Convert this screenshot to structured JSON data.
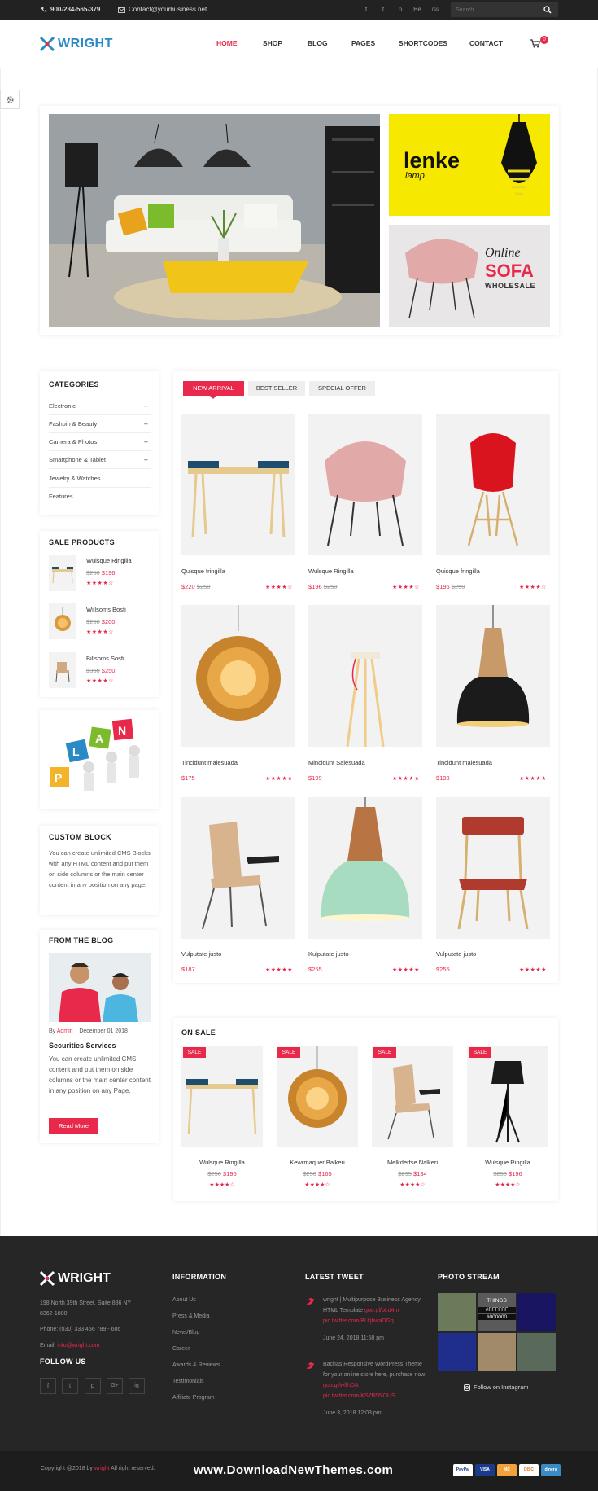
{
  "topbar": {
    "phone": "900-234-565-379",
    "email": "Contact@yourbusiness.net",
    "social": [
      "f",
      "t",
      "p",
      "Bē",
      "rss"
    ],
    "search_placeholder": "Search..."
  },
  "header": {
    "logo": "WRIGHT",
    "nav": [
      "HOME",
      "SHOP",
      "BLOG",
      "PAGES",
      "SHORTCODES",
      "CONTACT"
    ],
    "active_nav": "HOME",
    "cart_count": "0"
  },
  "hero": {
    "lenke_title": "lenke",
    "lenke_sub": "lamp",
    "sofa_line1": "Online",
    "sofa_line2": "SOFA",
    "sofa_line3": "WHOLESALE"
  },
  "categories": {
    "title": "CATEGORIES",
    "items": [
      {
        "label": "Electronic",
        "plus": "+"
      },
      {
        "label": "Fashoin & Beauty",
        "plus": "+"
      },
      {
        "label": "Camera & Photos",
        "plus": "+"
      },
      {
        "label": "Smartphone & Tablet",
        "plus": "+"
      },
      {
        "label": "Jewelry & Watches",
        "plus": ""
      },
      {
        "label": "Features",
        "plus": ""
      }
    ]
  },
  "sale_products": {
    "title": "SALE PRODUCTS",
    "items": [
      {
        "name": "Wulsque Ringilla",
        "old": "$250",
        "new": "$196",
        "stars": "★★★★☆"
      },
      {
        "name": "Willsoms Bosfi",
        "old": "$250",
        "new": "$200",
        "stars": "★★★★☆"
      },
      {
        "name": "Billsoms Sosfi",
        "old": "$350",
        "new": "$250",
        "stars": "★★★★☆"
      }
    ]
  },
  "plan_banner": {
    "letters": [
      "P",
      "L",
      "A",
      "N"
    ]
  },
  "custom_block": {
    "title": "CUSTOM BLOCK",
    "text": "You can create unlimited CMS Blocks with any HTML content and put them on side columns or the main center content in any position on any page."
  },
  "blog": {
    "title": "FROM THE BLOG",
    "by": "By",
    "author": "Admin",
    "date": "December 01 2018",
    "post_title": "Securities Services",
    "text": "You can create unlimited CMS content and put them on side columns or the main center content in any position on any Page.",
    "button": "Read More"
  },
  "tabs": [
    "NEW ARRIVAL",
    "BEST SELLER",
    "SPECIAL OFFER"
  ],
  "products": [
    {
      "name": "Quisque fringilla",
      "price": "$220",
      "old": "$250",
      "stars": "★★★★☆"
    },
    {
      "name": "Wulsque Ringilla",
      "price": "$196",
      "old": "$250",
      "stars": "★★★★☆"
    },
    {
      "name": "Quisque fringilla",
      "price": "$196",
      "old": "$250",
      "stars": "★★★★☆"
    },
    {
      "name": "Tincidunt malesuada",
      "price": "$175",
      "old": "",
      "stars": "★★★★★"
    },
    {
      "name": "Mincidunt Salesuada",
      "price": "$199",
      "old": "",
      "stars": "★★★★★"
    },
    {
      "name": "Tincidunt malesuada",
      "price": "$199",
      "old": "",
      "stars": "★★★★★"
    },
    {
      "name": "Vulputate justo",
      "price": "$187",
      "old": "",
      "stars": "★★★★★"
    },
    {
      "name": "Kulputate justo",
      "price": "$255",
      "old": "",
      "stars": "★★★★★"
    },
    {
      "name": "Vulputate justo",
      "price": "$255",
      "old": "",
      "stars": "★★★★★"
    }
  ],
  "on_sale": {
    "title": "ON SALE",
    "badge": "SALE",
    "items": [
      {
        "name": "Wulsque Ringilla",
        "old": "$250",
        "new": "$196",
        "stars": "★★★★☆"
      },
      {
        "name": "Kewrmaquer Balkeri",
        "old": "$250",
        "new": "$165",
        "stars": "★★★★☆"
      },
      {
        "name": "Melkderfse Nalkeri",
        "old": "$295",
        "new": "$134",
        "stars": "★★★★☆"
      },
      {
        "name": "Wulsque Ringilla",
        "old": "$250",
        "new": "$196",
        "stars": "★★★★☆"
      }
    ]
  },
  "footer": {
    "logo": "WRIGHT",
    "address": "198 North 39th Street, Suite 836 NY 8362-1800",
    "phone": "Phone: (030) 333 456 789 - 686",
    "email_label": "Email:",
    "email": "info@wright.com",
    "follow_title": "FOLLOW US",
    "social": [
      "f",
      "t",
      "p",
      "G+",
      "ig"
    ],
    "info_title": "INFORMATION",
    "info_links": [
      "About Us",
      "Press & Media",
      "News/Blog",
      "Career",
      "Awards & Reviews",
      "Testimonials",
      "Affiliate Program"
    ],
    "tweet_title": "LATEST TWEET",
    "tweets": [
      {
        "text": "wright | Multipurpose Business Agency HTML Template",
        "link1": "goo.gl/bt.d4m",
        "link2": "pic.twitter.com/BUtjhwaDGq",
        "date": "June 24, 2018 11:58 pm"
      },
      {
        "text": "Bachas Responsive WordPress Theme for your online store here, purchase now",
        "link1": "goo.gl/wfthDA",
        "link2": "pic.twitter.com/KS7B56lOUS",
        "date": "June 3, 2018 12:03 pm"
      }
    ],
    "photo_title": "PHOTO STREAM",
    "photo_labels": [
      "THINGS",
      "#FFFFFF",
      "#000000"
    ],
    "instagram": "Follow on Instagram"
  },
  "bottom": {
    "copy_prefix": "Copyright @2018 by",
    "copy_brand": "wright",
    "copy_suffix": "All right reserved.",
    "watermark": "www.DownloadNewThemes.com",
    "payments": [
      "PayPal",
      "VISA",
      "MC",
      "DISC",
      "diners"
    ]
  }
}
